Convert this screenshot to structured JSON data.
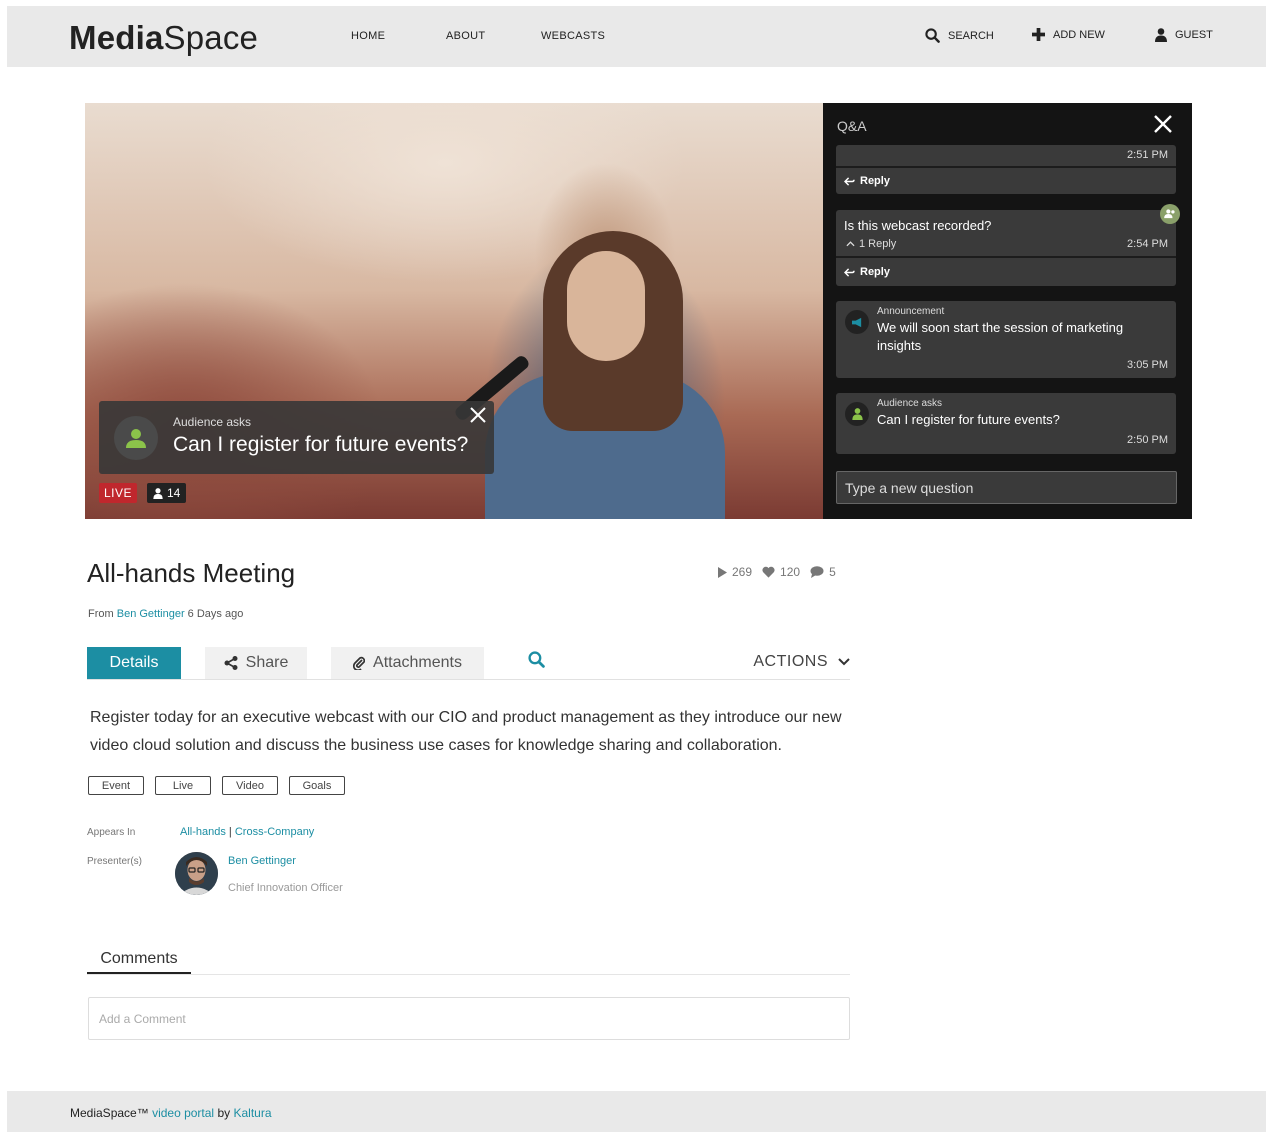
{
  "header": {
    "logo_bold": "Media",
    "logo_regular": "Space",
    "nav": [
      "HOME",
      "ABOUT",
      "WEBCASTS"
    ],
    "search_label": "SEARCH",
    "add_new_label": "ADD NEW",
    "guest_label": "GUEST"
  },
  "player": {
    "overlay": {
      "label": "Audience asks",
      "question": "Can I register for future events?"
    },
    "live_label": "LIVE",
    "viewer_count": "14"
  },
  "qa": {
    "title": "Q&A",
    "cards": [
      {
        "time": "2:51 PM",
        "reply_label": "Reply"
      },
      {
        "question": "Is this webcast recorded?",
        "reply_count": "1 Reply",
        "time": "2:54 PM",
        "reply_label": "Reply"
      },
      {
        "label": "Announcement",
        "body": "We will soon start the session of marketing insights",
        "time": "3:05 PM"
      },
      {
        "label": "Audience asks",
        "body": "Can I register for future events?",
        "time": "2:50 PM"
      }
    ],
    "input_placeholder": "Type a new question"
  },
  "entry": {
    "title": "All-hands Meeting",
    "stats": {
      "plays": "269",
      "likes": "120",
      "comments": "5"
    },
    "from_prefix": "From",
    "author": "Ben Gettinger",
    "age": "6 Days ago",
    "tabs": [
      "Details",
      "Share",
      "Attachments"
    ],
    "actions_label": "ACTIONS",
    "description": "Register today for an executive webcast with our CIO and product management as they introduce our new video cloud solution and discuss the business use cases for knowledge sharing and collaboration.",
    "tags": [
      "Event",
      "Live",
      "Video",
      "Goals"
    ],
    "appears_in_label": "Appears In",
    "appears_in": [
      "All-hands",
      "Cross-Company"
    ],
    "appears_sep": " | ",
    "presenters_label": "Presenter(s)",
    "presenter": {
      "name": "Ben Gettinger",
      "role": "Chief Innovation Officer"
    }
  },
  "comments": {
    "tab_label": "Comments",
    "input_placeholder": "Add a Comment"
  },
  "footer": {
    "product": "MediaSpace™",
    "link_text": "video portal",
    "by": "by",
    "vendor": "Kaltura"
  },
  "colors": {
    "accent": "#1c8ea3",
    "live": "#c0272d",
    "header_bg": "#e9e9e9",
    "qa_bg": "#141414",
    "qa_card": "#3a3a3a"
  }
}
